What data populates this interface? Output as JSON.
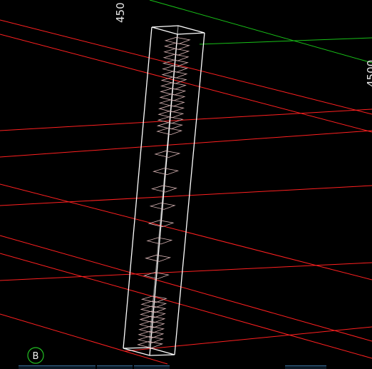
{
  "viewport": {
    "background": "#000000",
    "grid_line_color": "#ff2020",
    "secondary_line_color": "#18c018",
    "model_color": "#ffffff",
    "rebar_color": "#d8b4b4"
  },
  "grid_labels": {
    "top_label": "450",
    "right_label": "4500"
  },
  "axis_bubble": {
    "label": "B",
    "color": "#22c022"
  }
}
